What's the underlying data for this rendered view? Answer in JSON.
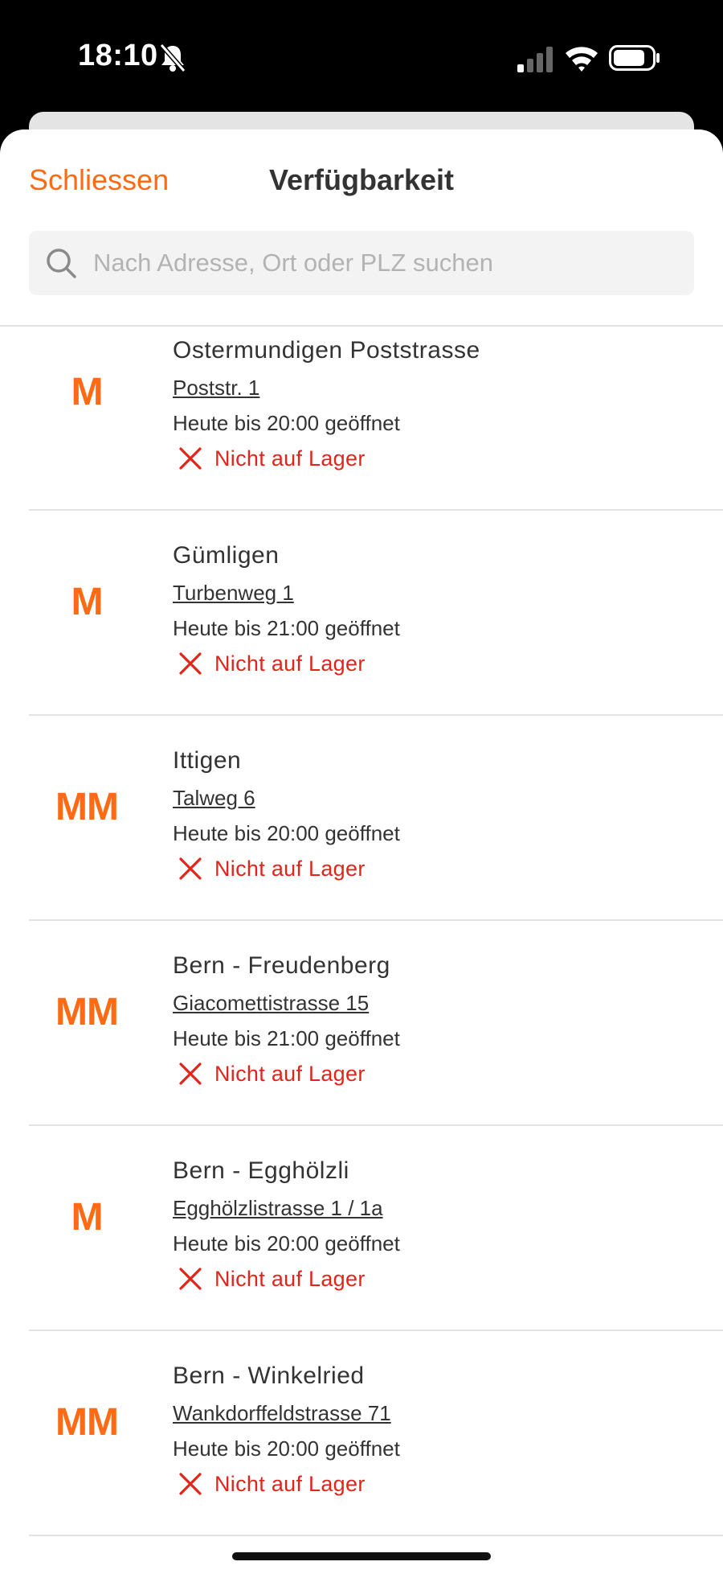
{
  "status_bar": {
    "time": "18:10"
  },
  "header": {
    "close_label": "Schliessen",
    "title": "Verfügbarkeit"
  },
  "search": {
    "placeholder": "Nach Adresse, Ort oder PLZ suchen"
  },
  "colors": {
    "accent": "#ff6a13",
    "out_of_stock": "#e1251b"
  },
  "stores": [
    {
      "logo": "M",
      "name": "Ostermundigen Poststrasse",
      "address": "Poststr. 1",
      "hours": "Heute bis 20:00 geöffnet",
      "stock": "Nicht auf Lager"
    },
    {
      "logo": "M",
      "name": "Gümligen",
      "address": "Turbenweg 1",
      "hours": "Heute bis 21:00 geöffnet",
      "stock": "Nicht auf Lager"
    },
    {
      "logo": "MM",
      "name": "Ittigen",
      "address": "Talweg 6",
      "hours": "Heute bis 20:00 geöffnet",
      "stock": "Nicht auf Lager"
    },
    {
      "logo": "MM",
      "name": "Bern - Freudenberg",
      "address": "Giacomettistrasse 15",
      "hours": "Heute bis 21:00 geöffnet",
      "stock": "Nicht auf Lager"
    },
    {
      "logo": "M",
      "name": "Bern - Egghölzli",
      "address": "Egghölzlistrasse 1 / 1a",
      "hours": "Heute bis 20:00 geöffnet",
      "stock": "Nicht auf Lager"
    },
    {
      "logo": "MM",
      "name": "Bern - Winkelried",
      "address": "Wankdorffeldstrasse 71",
      "hours": "Heute bis 20:00 geöffnet",
      "stock": "Nicht auf Lager"
    }
  ]
}
